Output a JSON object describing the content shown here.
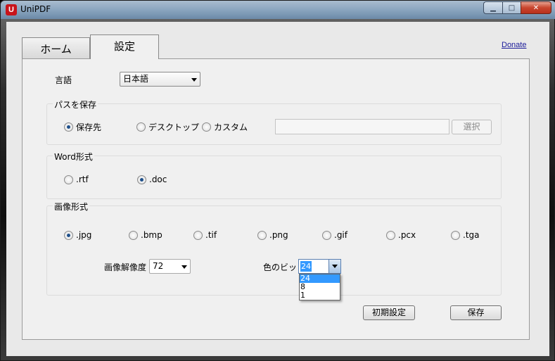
{
  "window": {
    "title": "UniPDF",
    "icon_letter": "U",
    "controls": {
      "minimize": "▁",
      "maximize": "□",
      "close": "✕"
    }
  },
  "tabs": [
    {
      "label": "ホーム",
      "selected": false
    },
    {
      "label": "設定",
      "selected": true
    }
  ],
  "donate_label": "Donate",
  "language": {
    "label": "言語",
    "value": "日本語"
  },
  "save_path": {
    "title": "パスを保存",
    "options": [
      "保存先",
      "デスクトップ",
      "カスタム"
    ],
    "selected": "保存先",
    "path_value": "",
    "browse_label": "選択"
  },
  "word_format": {
    "title": "Word形式",
    "options": [
      ".rtf",
      ".doc"
    ],
    "selected": ".doc"
  },
  "image_format": {
    "title": "画像形式",
    "options": [
      ".jpg",
      ".bmp",
      ".tif",
      ".png",
      ".gif",
      ".pcx",
      ".tga"
    ],
    "selected": ".jpg",
    "resolution_label": "画像解像度",
    "resolution_value": "72",
    "bits_label": "色のビット",
    "bits_value": "24",
    "bits_options": [
      "24",
      "8",
      "1"
    ]
  },
  "buttons": {
    "reset": "初期設定",
    "save": "保存"
  },
  "colors": {
    "accent": "#3399ff",
    "titlebar": "#8aa5bf",
    "close": "#c9452d",
    "app_icon": "#c8141b"
  }
}
